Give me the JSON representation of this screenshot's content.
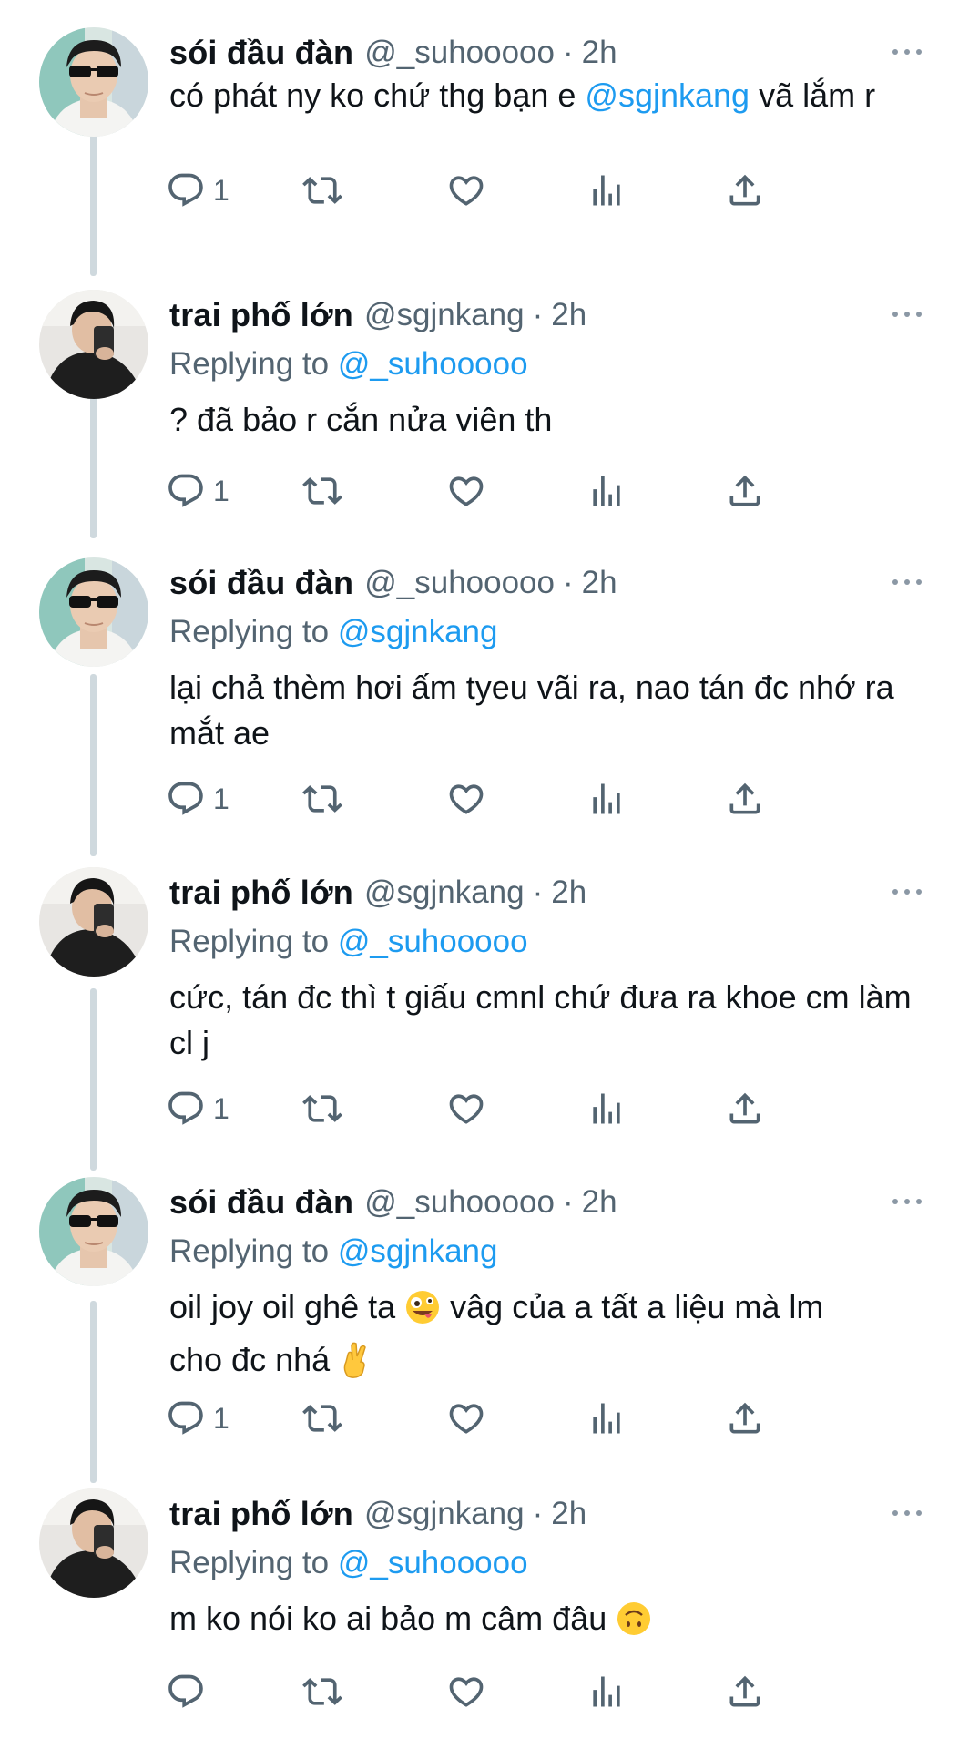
{
  "tweets": [
    {
      "name": "sói đầu đàn",
      "handle": "@_suhooooo",
      "dot": "·",
      "time": "2h",
      "replying_label": "",
      "replying_handle": "",
      "text_before": "có phát ny ko chứ thg bạn e ",
      "text_mention": "@sgjnkang",
      "text_after": " vã lắm r",
      "reply_count": "1",
      "avatar": "avatar-sunglasses"
    },
    {
      "name": "trai phố lớn",
      "handle": "@sgjnkang",
      "dot": "·",
      "time": "2h",
      "replying_label": "Replying to ",
      "replying_handle": "@_suhooooo",
      "text": "? đã bảo r cắn nửa viên th",
      "reply_count": "1",
      "avatar": "avatar-mirror-selfie"
    },
    {
      "name": "sói đầu đàn",
      "handle": "@_suhooooo",
      "dot": "·",
      "time": "2h",
      "replying_label": "Replying to ",
      "replying_handle": "@sgjnkang",
      "text": "lại chả thèm hơi ấm tyeu vãi ra, nao tán đc nhớ ra mắt ae",
      "reply_count": "1",
      "avatar": "avatar-sunglasses"
    },
    {
      "name": "trai phố lớn",
      "handle": "@sgjnkang",
      "dot": "·",
      "time": "2h",
      "replying_label": "Replying to ",
      "replying_handle": "@_suhooooo",
      "text": "cức, tán đc thì t giấu cmnl chứ đưa ra khoe cm làm cl j",
      "reply_count": "1",
      "avatar": "avatar-mirror-selfie"
    },
    {
      "name": "sói đầu đàn",
      "handle": "@_suhooooo",
      "dot": "·",
      "time": "2h",
      "replying_label": "Replying to ",
      "replying_handle": "@sgjnkang",
      "text_line1_before": "oil joy oil ghê ta ",
      "emoji1": "zany-face",
      "text_line1_after": " vâg của a tất a liệu mà lm",
      "text_line2": "cho đc nhá ",
      "emoji2": "crossed-fingers",
      "reply_count": "1",
      "avatar": "avatar-sunglasses"
    },
    {
      "name": "trai phố lớn",
      "handle": "@sgjnkang",
      "dot": "·",
      "time": "2h",
      "replying_label": "Replying to ",
      "replying_handle": "@_suhooooo",
      "text": "m ko nói ko ai bảo m câm đâu ",
      "emoji": "upside-down-face",
      "reply_count": "",
      "avatar": "avatar-mirror-selfie"
    }
  ],
  "colors": {
    "text": "#0f1419",
    "secondary": "#536471",
    "link": "#1d9bf0",
    "thread_line": "#cfd9de"
  },
  "icons": [
    "reply-icon",
    "retweet-icon",
    "like-icon",
    "views-icon",
    "share-icon",
    "more-icon"
  ]
}
